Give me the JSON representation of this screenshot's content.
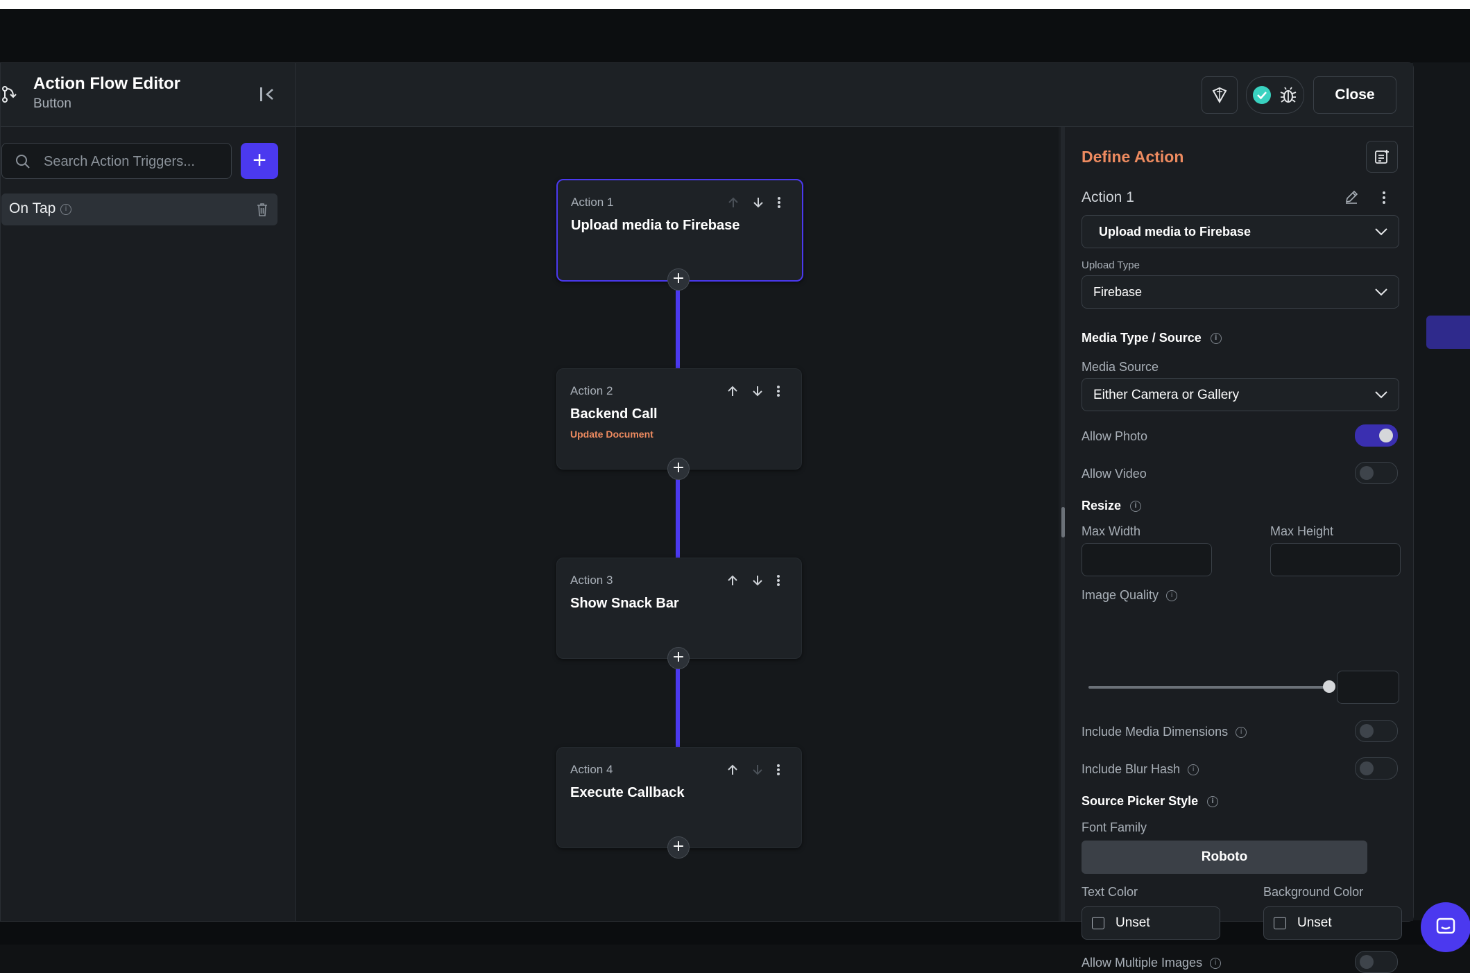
{
  "header": {
    "title": "Action Flow Editor",
    "subtitle": "Button",
    "close_label": "Close"
  },
  "sidebar": {
    "search_placeholder": "Search Action Triggers...",
    "add_label": "+",
    "triggers": [
      {
        "label": "On Tap"
      }
    ]
  },
  "flow": {
    "actions": [
      {
        "number": "Action 1",
        "title": "Upload media to Firebase",
        "subtitle": ""
      },
      {
        "number": "Action 2",
        "title": "Backend Call",
        "subtitle": "Update Document"
      },
      {
        "number": "Action 3",
        "title": "Show Snack Bar",
        "subtitle": ""
      },
      {
        "number": "Action 4",
        "title": "Execute Callback",
        "subtitle": ""
      }
    ]
  },
  "panel": {
    "title": "Define Action",
    "action_name": "Action 1",
    "action_type": "Upload media to Firebase",
    "upload_type_label": "Upload Type",
    "upload_type_value": "Firebase",
    "media_section": "Media Type / Source",
    "media_source_label": "Media Source",
    "media_source_value": "Either Camera or Gallery",
    "allow_photo_label": "Allow Photo",
    "allow_photo": true,
    "allow_video_label": "Allow Video",
    "allow_video": false,
    "resize_section": "Resize",
    "max_width_label": "Max Width",
    "max_height_label": "Max Height",
    "image_quality_label": "Image Quality",
    "image_quality_fraction": 1.0,
    "include_dimensions_label": "Include Media Dimensions",
    "include_dimensions": false,
    "include_blurhash_label": "Include Blur Hash",
    "include_blurhash": false,
    "picker_section": "Source Picker Style",
    "font_family_label": "Font Family",
    "font_family_value": "Roboto",
    "text_color_label": "Text Color",
    "text_color_value": "Unset",
    "bg_color_label": "Background Color",
    "bg_color_value": "Unset",
    "allow_multiple_label": "Allow Multiple Images",
    "allow_multiple": false
  },
  "colors": {
    "accent": "#4b39ef",
    "orange": "#ee8b60",
    "success": "#39d2c0"
  }
}
